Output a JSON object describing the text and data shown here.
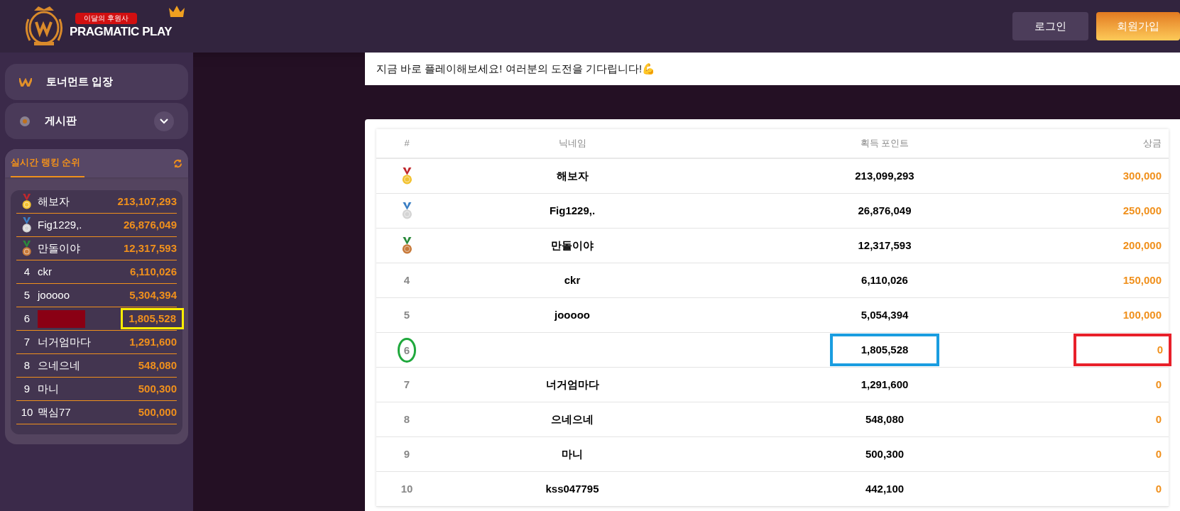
{
  "header": {
    "logo": {
      "badge": "이달의 후원사",
      "brand": "PRAGMATIC PLAY"
    },
    "buttons": [
      {
        "label": "로그인",
        "kind": "secondary"
      },
      {
        "label": "회원가입",
        "kind": "primary"
      }
    ]
  },
  "sidebar": {
    "menu": [
      {
        "label": "토너먼트 입장",
        "kind": "link",
        "expandable": false
      },
      {
        "label": "게시판",
        "kind": "folder",
        "expandable": true
      }
    ],
    "ranking": {
      "tab": {
        "label": "실시간 랭킹 순위",
        "selected": true
      },
      "rows": [
        {
          "kind": "gold",
          "name": "해보자",
          "score": "213,107,293"
        },
        {
          "kind": "silver",
          "name": "Fig1229,.",
          "score": "26,876,049"
        },
        {
          "kind": "bronze",
          "name": "만돌이야",
          "score": "12,317,593"
        },
        {
          "kind": "number",
          "rank": "4",
          "name": "ckr",
          "score": "6,110,026"
        },
        {
          "kind": "number",
          "rank": "5",
          "name": "jooooo",
          "score": "5,304,394"
        },
        {
          "kind": "number",
          "rank": "6",
          "redacted": true,
          "score": "1,805,528",
          "score_highlight": {
            "color": "#ffee00"
          }
        },
        {
          "kind": "number",
          "rank": "7",
          "name": "너거엄마다",
          "score": "1,291,600"
        },
        {
          "kind": "number",
          "rank": "8",
          "name": "으네으네",
          "score": "548,080"
        },
        {
          "kind": "number",
          "rank": "9",
          "name": "마니",
          "score": "500,300"
        },
        {
          "kind": "number",
          "rank": "10",
          "name": "맥심77",
          "score": "500,000"
        }
      ]
    }
  },
  "notice": "지금 바로 플레이해보세요! 여러분의 도전을 기다립니다!💪",
  "table": {
    "columns": [
      "#",
      "닉네임",
      "획득 포인트",
      "상금"
    ],
    "rows": [
      {
        "kind": "gold",
        "name": "해보자",
        "points": "213,099,293",
        "prize": "300,000"
      },
      {
        "kind": "silver",
        "name": "Fig1229,.",
        "points": "26,876,049",
        "prize": "250,000"
      },
      {
        "kind": "bronze",
        "name": "만돌이야",
        "points": "12,317,593",
        "prize": "200,000"
      },
      {
        "kind": "number",
        "rank": "4",
        "name": "ckr",
        "points": "6,110,026",
        "prize": "150,000"
      },
      {
        "kind": "number",
        "rank": "5",
        "name": "jooooo",
        "points": "5,054,394",
        "prize": "100,000"
      },
      {
        "kind": "number",
        "rank": "6",
        "points": "1,805,528",
        "prize": "0",
        "rank_highlight": {
          "color": "#1fa83c"
        },
        "points_highlight": {
          "color": "#1a9de0"
        },
        "prize_highlight": {
          "color": "#e8202a"
        }
      },
      {
        "kind": "number",
        "rank": "7",
        "name": "너거엄마다",
        "points": "1,291,600",
        "prize": "0"
      },
      {
        "kind": "number",
        "rank": "8",
        "name": "으네으네",
        "points": "548,080",
        "prize": "0"
      },
      {
        "kind": "number",
        "rank": "9",
        "name": "마니",
        "points": "500,300",
        "prize": "0"
      },
      {
        "kind": "number",
        "rank": "10",
        "name": "kss047795",
        "points": "442,100",
        "prize": "0"
      }
    ]
  }
}
